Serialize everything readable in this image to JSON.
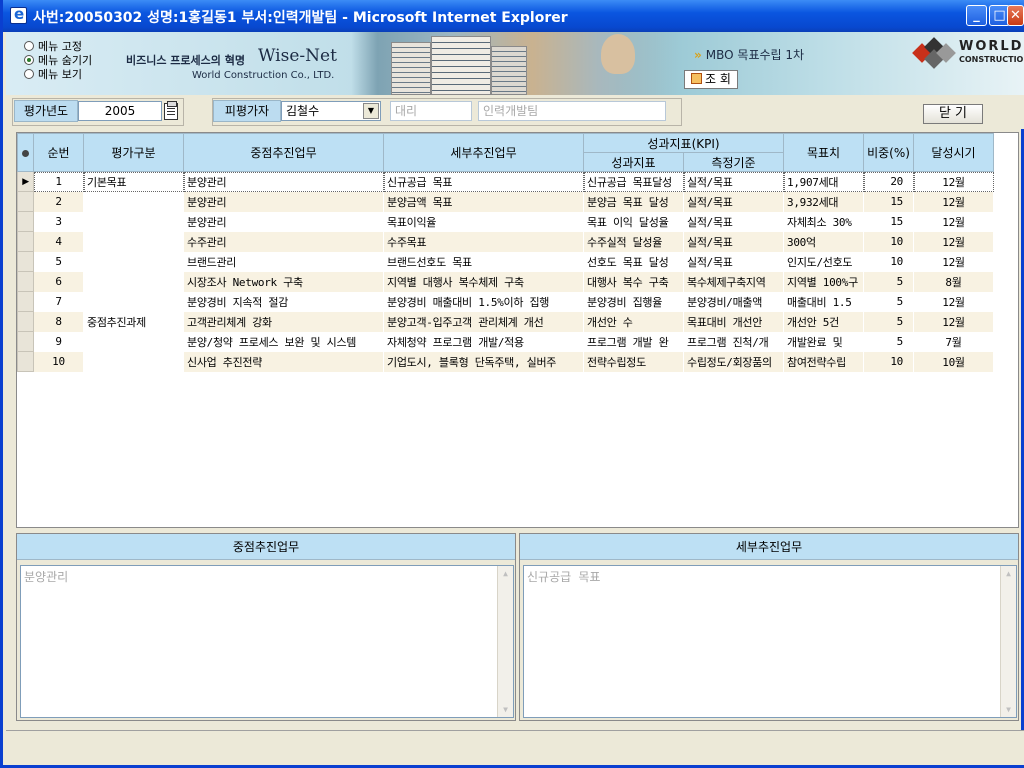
{
  "window": {
    "title": "사번:20050302 성명:1홍길동1 부서:인력개발팀 - Microsoft Internet Explorer",
    "controls": [
      "minimize-icon",
      "maximize-icon",
      "close-icon"
    ]
  },
  "header": {
    "menu_options": [
      {
        "label": "메뉴 고정",
        "selected": false
      },
      {
        "label": "메뉴 숨기기",
        "selected": true
      },
      {
        "label": "메뉴 보기",
        "selected": false
      }
    ],
    "slogan": "비즈니스 프로세스의 혁명",
    "brand": "Wise-Net",
    "brand_sub": "World Construction Co., LTD.",
    "mbo_title": "MBO 목표수립 1차",
    "search_button": "조 회",
    "logo_main": "WORLD",
    "logo_sub": "CONSTRUCTION"
  },
  "filter": {
    "year_label": "평가년도",
    "year_value": "2005",
    "evaluatee_label": "피평가자",
    "evaluatee_value": "김철수",
    "position_value": "대리",
    "department_value": "인력개발팀",
    "close_button": "닫 기"
  },
  "grid": {
    "headers": {
      "seq": "순번",
      "category": "평가구분",
      "main_task": "중점추진업무",
      "detail_task": "세부추진업무",
      "kpi": "성과지표(KPI)",
      "kpi_indicator": "성과지표",
      "kpi_criteria": "측정기준",
      "target": "목표치",
      "weight": "비중(%)",
      "period": "달성시기"
    },
    "rows": [
      {
        "seq": "1",
        "category": "기본목표",
        "main": "분양관리",
        "detail": "신규공급 목표",
        "kpi": "신규공급 목표달성",
        "criteria": "실적/목표",
        "target": "1,907세대",
        "weight": "20",
        "period": "12월"
      },
      {
        "seq": "2",
        "category": "",
        "main": "분양관리",
        "detail": "분양금액 목표",
        "kpi": "분양금 목표 달성",
        "criteria": "실적/목표",
        "target": "3,932세대",
        "weight": "15",
        "period": "12월"
      },
      {
        "seq": "3",
        "category": "",
        "main": "분양관리",
        "detail": "목표이익율",
        "kpi": "목표 이익 달성율",
        "criteria": "실적/목표",
        "target": "자체최소 30%",
        "weight": "15",
        "period": "12월"
      },
      {
        "seq": "4",
        "category": "",
        "main": "수주관리",
        "detail": "수주목표",
        "kpi": "수주실적 달성율",
        "criteria": "실적/목표",
        "target": "300억",
        "weight": "10",
        "period": "12월"
      },
      {
        "seq": "5",
        "category": "",
        "main": "브랜드관리",
        "detail": "브랜드선호도 목표",
        "kpi": "선호도 목표 달성",
        "criteria": "실적/목표",
        "target": "인지도/선호도",
        "weight": "10",
        "period": "12월"
      },
      {
        "seq": "6",
        "category": "중점추진과제",
        "main": "시장조사 Network 구축",
        "detail": "지역별 대행사 복수체제 구축",
        "kpi": "대행사 복수 구축",
        "criteria": "복수체제구축지역",
        "target": "지역별 100%구",
        "weight": "5",
        "period": "8월"
      },
      {
        "seq": "7",
        "category": "",
        "main": "분양경비 지속적 절감",
        "detail": "분양경비 매출대비 1.5%이하 집행",
        "kpi": "분양경비 집행율",
        "criteria": "분양경비/매출액",
        "target": "매출대비 1.5",
        "weight": "5",
        "period": "12월"
      },
      {
        "seq": "8",
        "category": "",
        "main": "고객관리체계 강화",
        "detail": "분양고객-입주고객 관리체계 개선",
        "kpi": "개선안 수",
        "criteria": "목표대비 개선안",
        "target": "개선안 5건",
        "weight": "5",
        "period": "12월"
      },
      {
        "seq": "9",
        "category": "",
        "main": "분양/청약 프로세스 보완 및 시스템",
        "detail": "자체청약 프로그램 개발/적용",
        "kpi": "프로그램 개발 완",
        "criteria": "프로그램 진척/개",
        "target": "개발완료 및 ",
        "weight": "5",
        "period": "7월"
      },
      {
        "seq": "10",
        "category": "",
        "main": "신사업 추진전략",
        "detail": "기업도시, 블록형 단독주택, 실버주",
        "kpi": "전략수립정도",
        "criteria": "수립정도/회장품의",
        "target": "참여전략수립",
        "weight": "10",
        "period": "10월"
      }
    ]
  },
  "detail": {
    "main_label": "중점추진업무",
    "main_value": "분양관리",
    "detail_label": "세부추진업무",
    "detail_value": "신규공급 목표"
  }
}
